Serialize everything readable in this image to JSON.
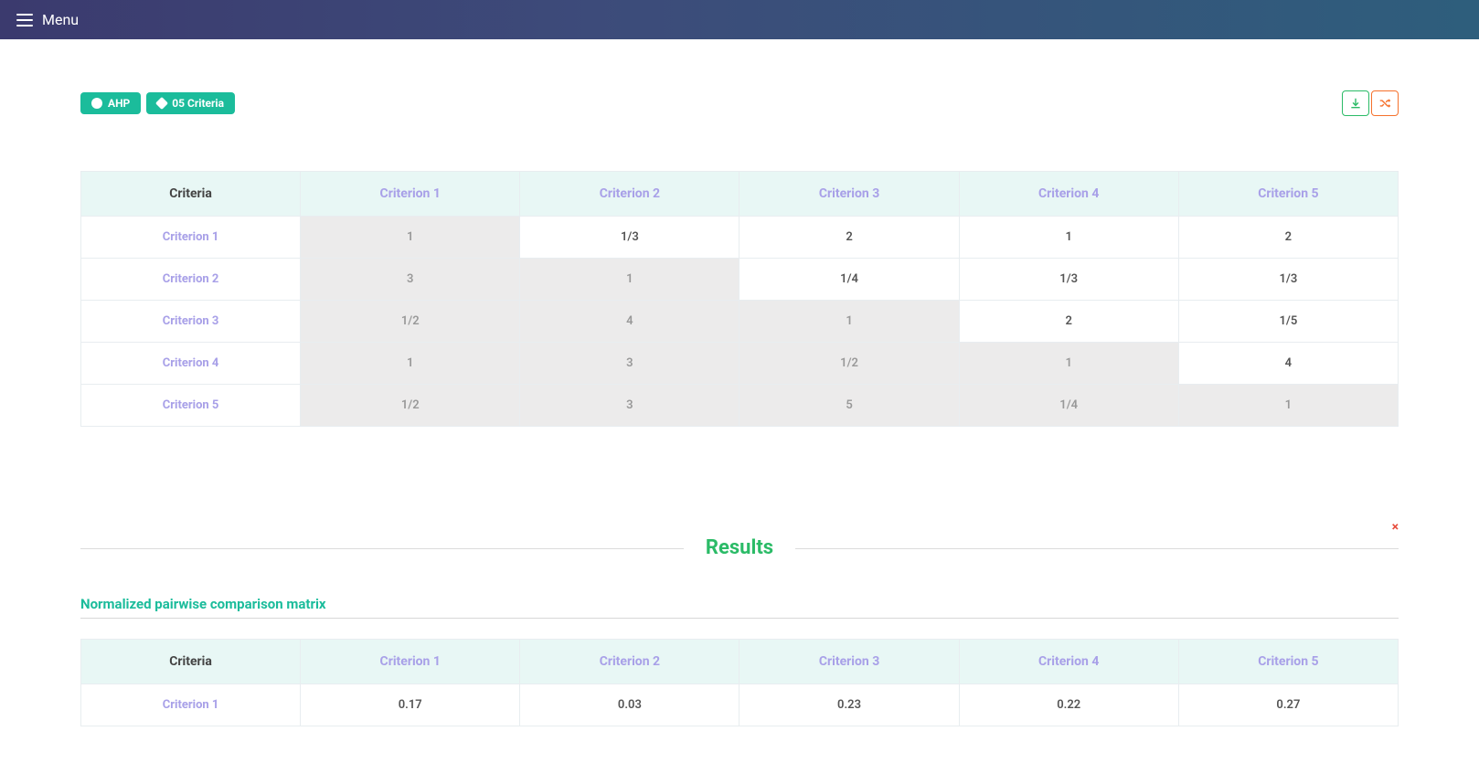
{
  "topbar": {
    "menu_label": "Menu"
  },
  "badges": {
    "method": "AHP",
    "criteria_count": "05 Criteria"
  },
  "actions": {
    "download_title": "Download",
    "random_title": "Shuffle"
  },
  "comparison_table": {
    "header_first": "Criteria",
    "col_headers": [
      "Criterion 1",
      "Criterion 2",
      "Criterion 3",
      "Criterion 4",
      "Criterion 5"
    ],
    "rows": [
      {
        "label": "Criterion 1",
        "cells": [
          "1",
          "1/3",
          "2",
          "1",
          "2"
        ]
      },
      {
        "label": "Criterion 2",
        "cells": [
          "3",
          "1",
          "1/4",
          "1/3",
          "1/3"
        ]
      },
      {
        "label": "Criterion 3",
        "cells": [
          "1/2",
          "4",
          "1",
          "2",
          "1/5"
        ]
      },
      {
        "label": "Criterion 4",
        "cells": [
          "1",
          "3",
          "1/2",
          "1",
          "4"
        ]
      },
      {
        "label": "Criterion 5",
        "cells": [
          "1/2",
          "3",
          "5",
          "1/4",
          "1"
        ]
      }
    ]
  },
  "results": {
    "heading": "Results",
    "close_label": "×",
    "normalized_heading": "Normalized pairwise comparison matrix",
    "table": {
      "header_first": "Criteria",
      "col_headers": [
        "Criterion 1",
        "Criterion 2",
        "Criterion 3",
        "Criterion 4",
        "Criterion 5"
      ],
      "rows": [
        {
          "label": "Criterion 1",
          "cells": [
            "0.17",
            "0.03",
            "0.23",
            "0.22",
            "0.27"
          ]
        }
      ]
    }
  }
}
